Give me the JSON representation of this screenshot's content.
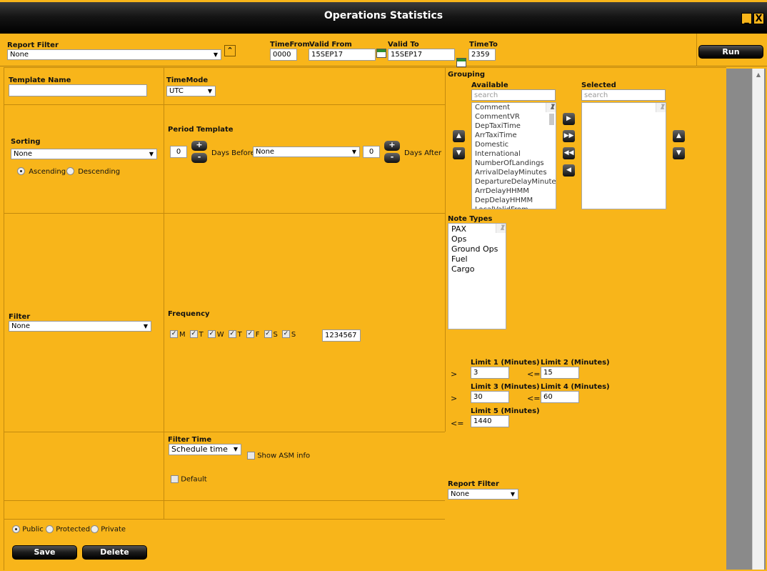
{
  "window": {
    "title": "Operations Statistics",
    "minimize_glyph": "_",
    "close_glyph": "X"
  },
  "header": {
    "report_filter_label": "Report Filter",
    "report_filter_value": "None",
    "time_from_label": "TimeFrom",
    "time_from_value": "0000",
    "valid_from_label": "Valid From",
    "valid_from_value": "15SEP17",
    "valid_to_label": "Valid To",
    "valid_to_value": "15SEP17",
    "time_to_label": "TimeTo",
    "time_to_value": "2359",
    "run_label": "Run"
  },
  "template": {
    "name_label": "Template Name",
    "name_value": ""
  },
  "timemode": {
    "label": "TimeMode",
    "value": "UTC"
  },
  "sorting": {
    "label": "Sorting",
    "value": "None",
    "ascending_label": "Ascending",
    "descending_label": "Descending"
  },
  "period": {
    "label": "Period Template",
    "days_before_value": "0",
    "days_before_label": "Days Before",
    "select_value": "None",
    "days_after_value": "0",
    "days_after_label": "Days After",
    "plus": "+",
    "minus": "-"
  },
  "grouping": {
    "label": "Grouping",
    "available_label": "Available",
    "selected_label": "Selected",
    "search_placeholder": "search",
    "available_items": [
      "Comment",
      "CommentVR",
      "DepTaxiTime",
      "ArrTaxiTime",
      "Domestic",
      "International",
      "NumberOfLandings",
      "ArrivalDelayMinutes",
      "DepartureDelayMinute",
      "ArrDelayHHMM",
      "DepDelayHHMM",
      "LocalValidFrom"
    ]
  },
  "note_types": {
    "label": "Note Types",
    "items": [
      "PAX",
      "Ops",
      "Ground Ops",
      "Fuel",
      "Cargo"
    ]
  },
  "filter": {
    "label": "Filter",
    "value": "None"
  },
  "frequency": {
    "label": "Frequency",
    "days": [
      "M",
      "T",
      "W",
      "T",
      "F",
      "S",
      "S"
    ],
    "value": "1234567"
  },
  "limits": {
    "limit1_label": "Limit 1 (Minutes)",
    "limit1_value": "3",
    "limit1_op": ">",
    "limit2_label": "Limit 2 (Minutes)",
    "limit2_value": "15",
    "limit2_op": "<=",
    "limit3_label": "Limit 3 (Minutes)",
    "limit3_value": "30",
    "limit3_op": ">",
    "limit4_label": "Limit 4 (Minutes)",
    "limit4_value": "60",
    "limit4_op": "<=",
    "limit5_label": "Limit 5 (Minutes)",
    "limit5_value": "1440",
    "limit5_op": "<="
  },
  "filter_time": {
    "label": "Filter Time",
    "value": "Schedule time",
    "show_asm_label": "Show ASM info",
    "default_label": "Default"
  },
  "report_filter_bottom": {
    "label": "Report Filter",
    "value": "None"
  },
  "visibility": {
    "public_label": "Public",
    "protected_label": "Protected",
    "private_label": "Private"
  },
  "footer": {
    "save_label": "Save",
    "delete_label": "Delete"
  }
}
